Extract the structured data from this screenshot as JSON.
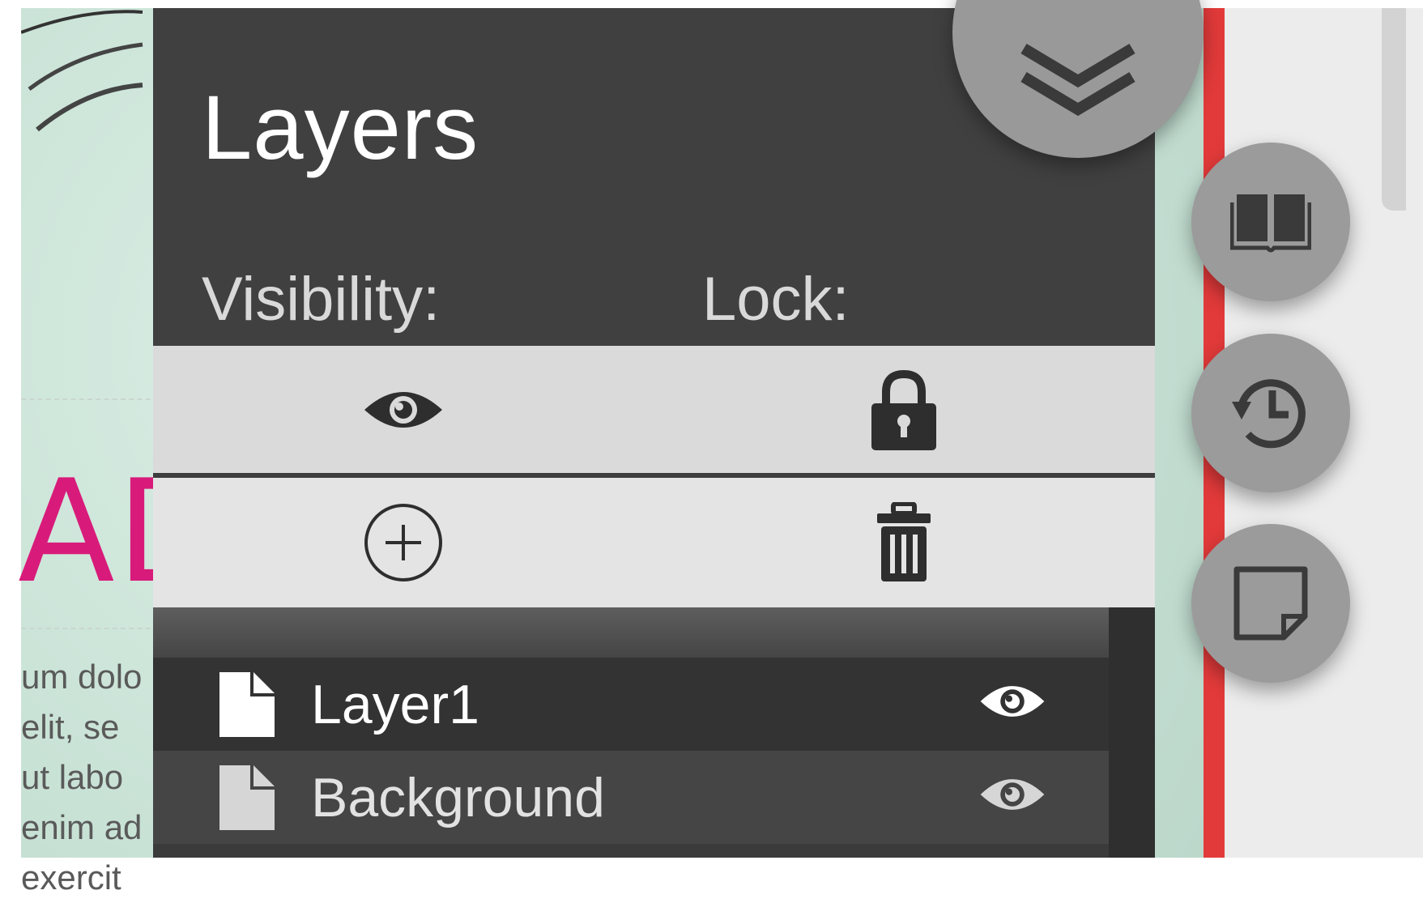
{
  "canvas": {
    "headline_fragment": "AD",
    "body_lines": [
      "um dolo",
      "elit, se",
      "ut labo",
      "enim ad",
      "exercit"
    ]
  },
  "layers_panel": {
    "title": "Layers",
    "visibility_label": "Visibility:",
    "lock_label": "Lock:",
    "layers": [
      {
        "name": "Layer1",
        "active": true,
        "visible": true
      },
      {
        "name": "Background",
        "active": false,
        "visible": true
      }
    ]
  },
  "icons": {
    "toggle_panel": "chevron-double-down-icon",
    "visibility": "eye-icon",
    "lock": "lock-icon",
    "add": "add-circle-icon",
    "delete": "trash-icon",
    "library": "book-icon",
    "history": "history-icon",
    "notes": "sticky-note-icon",
    "layer_file": "file-icon"
  },
  "colors": {
    "panel_bg": "#404040",
    "control_row_bg": "#dadada",
    "accent_red": "#e23a3a",
    "headline_magenta": "#d81b7a",
    "fab_bg": "#9b9b9b"
  }
}
